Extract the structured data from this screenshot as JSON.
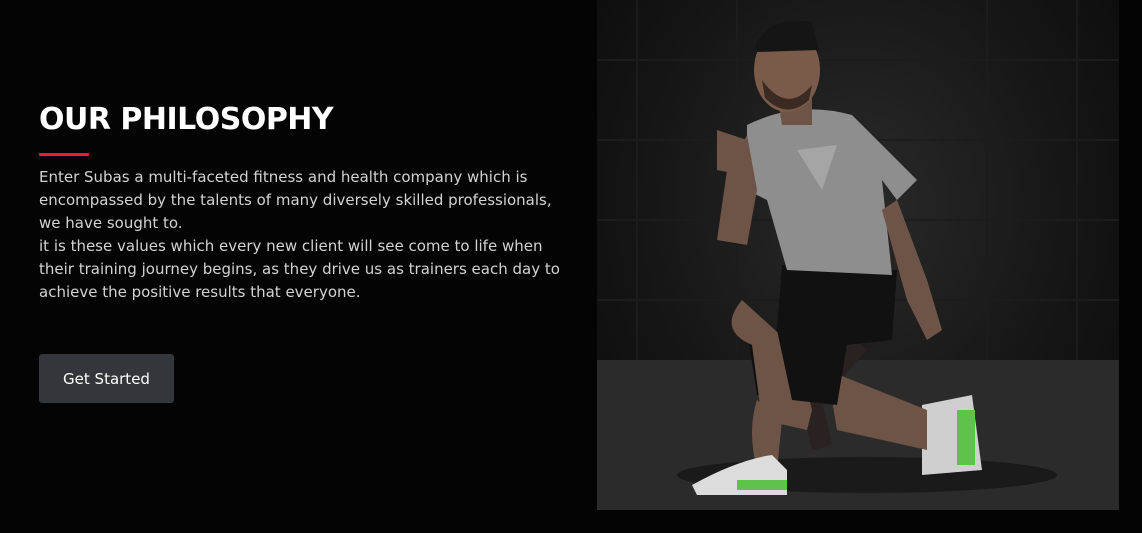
{
  "philosophy": {
    "title": "OUR PHILOSOPHY",
    "paragraph_1": "Enter Subas a multi-faceted fitness and health company which is encompassed by the talents of many diversely skilled professionals, we have sought to.",
    "paragraph_2": "it is these values which every new client will see come to life when their training journey begins, as they drive us as trainers each day to achieve the positive results that everyone.",
    "button_label": "Get Started"
  },
  "colors": {
    "background": "#040404",
    "accent": "#e3232c",
    "button": "#33373b"
  }
}
